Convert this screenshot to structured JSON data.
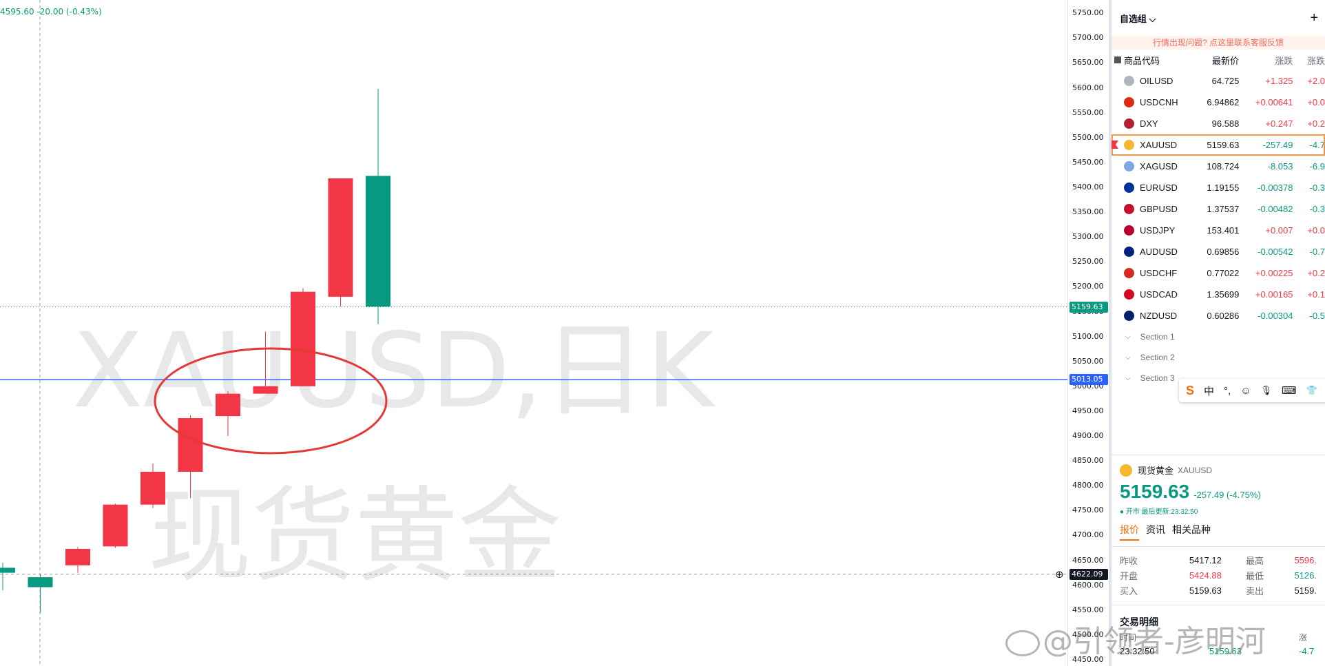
{
  "chart": {
    "symbol_watermark": "XAUUSD,日K",
    "name_watermark": "现货黄金",
    "ohlc_line": "4595.60  -20.00 (-0.43%)",
    "price_ticks": [
      "5750.00",
      "5700.00",
      "5650.00",
      "5600.00",
      "5550.00",
      "5500.00",
      "5450.00",
      "5400.00",
      "5350.00",
      "5300.00",
      "5250.00",
      "5200.00",
      "5150.00",
      "5100.00",
      "5050.00",
      "5000.00",
      "4950.00",
      "4900.00",
      "4850.00",
      "4800.00",
      "4750.00",
      "4700.00",
      "4650.00",
      "4600.00",
      "4550.00",
      "4500.00",
      "4450.00"
    ],
    "last_price_tag": "5159.63",
    "hline_tag": "5013.05",
    "crosshair_tag": "4622.09",
    "colors": {
      "up": "#089981",
      "down": "#f23645",
      "hline": "#2962ff",
      "ellipse": "#e53935"
    }
  },
  "chart_data": {
    "type": "candlestick",
    "ylim": [
      4450,
      5760
    ],
    "candles": [
      {
        "o": 4635,
        "h": 4645,
        "l": 4590,
        "c": 4625
      },
      {
        "o": 4596,
        "h": 4622,
        "l": 4545,
        "c": 4616
      },
      {
        "o": 4640,
        "h": 4677,
        "l": 4625,
        "c": 4673
      },
      {
        "o": 4678,
        "h": 4764,
        "l": 4675,
        "c": 4762
      },
      {
        "o": 4762,
        "h": 4845,
        "l": 4755,
        "c": 4828
      },
      {
        "o": 4828,
        "h": 4942,
        "l": 4775,
        "c": 4936
      },
      {
        "o": 4940,
        "h": 4990,
        "l": 4900,
        "c": 4985
      },
      {
        "o": 4985,
        "h": 5110,
        "l": 4985,
        "c": 5000
      },
      {
        "o": 5000,
        "h": 5197,
        "l": 5000,
        "c": 5190
      },
      {
        "o": 5180,
        "h": 5418,
        "l": 5160,
        "c": 5418
      },
      {
        "o": 5423,
        "h": 5598,
        "l": 5125,
        "c": 5160
      }
    ]
  },
  "watchlist": {
    "group_label": "自选组",
    "add_label": "+",
    "notice": "行情出现问题? 点这里联系客服反馈",
    "headers": {
      "symbol": "商品代码",
      "last": "最新价",
      "chg": "涨跌",
      "pct": "涨跌"
    },
    "rows": [
      {
        "symbol": "OILUSD",
        "last": "64.725",
        "chg": "+1.325",
        "pct": "+2.0",
        "dir": "up",
        "color": "#b2b5be"
      },
      {
        "symbol": "USDCNH",
        "last": "6.94862",
        "chg": "+0.00641",
        "pct": "+0.0",
        "dir": "up",
        "color": "#de2910"
      },
      {
        "symbol": "DXY",
        "last": "96.588",
        "chg": "+0.247",
        "pct": "+0.2",
        "dir": "up",
        "color": "#b22234"
      },
      {
        "symbol": "XAUUSD",
        "last": "5159.63",
        "chg": "-257.49",
        "pct": "-4.7",
        "dir": "dn",
        "color": "#f5b82e"
      },
      {
        "symbol": "XAGUSD",
        "last": "108.724",
        "chg": "-8.053",
        "pct": "-6.9",
        "dir": "dn",
        "color": "#7fa7e8"
      },
      {
        "symbol": "EURUSD",
        "last": "1.19155",
        "chg": "-0.00378",
        "pct": "-0.3",
        "dir": "dn",
        "color": "#003399"
      },
      {
        "symbol": "GBPUSD",
        "last": "1.37537",
        "chg": "-0.00482",
        "pct": "-0.3",
        "dir": "dn",
        "color": "#c8102e"
      },
      {
        "symbol": "USDJPY",
        "last": "153.401",
        "chg": "+0.007",
        "pct": "+0.0",
        "dir": "up",
        "color": "#bc002d"
      },
      {
        "symbol": "AUDUSD",
        "last": "0.69856",
        "chg": "-0.00542",
        "pct": "-0.7",
        "dir": "dn",
        "color": "#00247d"
      },
      {
        "symbol": "USDCHF",
        "last": "0.77022",
        "chg": "+0.00225",
        "pct": "+0.2",
        "dir": "up",
        "color": "#d52b1e"
      },
      {
        "symbol": "USDCAD",
        "last": "1.35699",
        "chg": "+0.00165",
        "pct": "+0.1",
        "dir": "up",
        "color": "#d80621"
      },
      {
        "symbol": "NZDUSD",
        "last": "0.60286",
        "chg": "-0.00304",
        "pct": "-0.5",
        "dir": "dn",
        "color": "#012169"
      }
    ],
    "sections": [
      "Section 1",
      "Section 2",
      "Section 3"
    ]
  },
  "ime": {
    "logo": "S",
    "lang": "中",
    "punct": "°,",
    "emoji": "☺",
    "mic": "🎙",
    "kbd": "⌨",
    "skin": "👕"
  },
  "detail": {
    "name": "现货黄金",
    "symbol": "XAUUSD",
    "price": "5159.63",
    "change": "-257.49 (-4.75%)",
    "status": "● 开市  最后更新:23:32:50",
    "tabs": [
      "报价",
      "资讯",
      "相关品种"
    ],
    "stats": [
      {
        "k1": "昨收",
        "v1": "5417.12",
        "k2": "最高",
        "v2": "5596."
      },
      {
        "k1": "开盘",
        "v1": "5424.88",
        "k2": "最低",
        "v2": "5126."
      },
      {
        "k1": "买入",
        "v1": "5159.63",
        "k2": "卖出",
        "v2": "5159."
      }
    ],
    "trades_title": "交易明细",
    "trades_head": [
      "时间",
      "",
      "涨"
    ],
    "trade_row": {
      "time": "23:32:50",
      "price": "5159.63",
      "pct": "-4.7"
    }
  },
  "weibo_watermark": "@引领者-彦明河"
}
